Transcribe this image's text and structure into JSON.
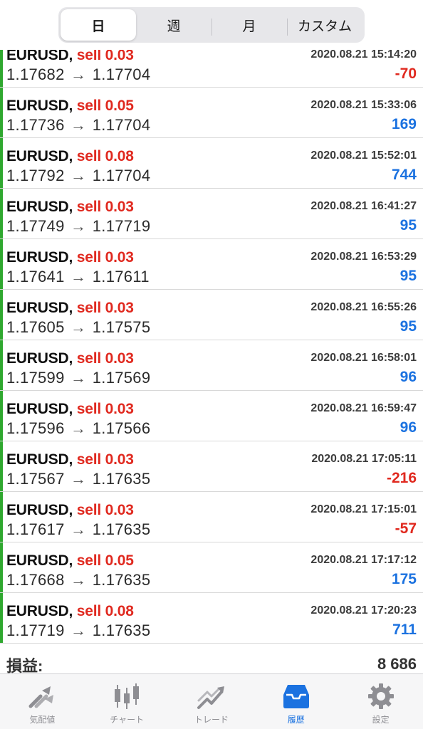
{
  "period_tabs": [
    "日",
    "週",
    "月",
    "カスタム"
  ],
  "active_period": 0,
  "trades": [
    {
      "symbol": "EURUSD",
      "action": "sell 0.03",
      "time": "2020.08.21 15:14:20",
      "open": "1.17682",
      "close": "1.17704",
      "profit": "-70",
      "positive": false
    },
    {
      "symbol": "EURUSD",
      "action": "sell 0.05",
      "time": "2020.08.21 15:33:06",
      "open": "1.17736",
      "close": "1.17704",
      "profit": "169",
      "positive": true
    },
    {
      "symbol": "EURUSD",
      "action": "sell 0.08",
      "time": "2020.08.21 15:52:01",
      "open": "1.17792",
      "close": "1.17704",
      "profit": "744",
      "positive": true
    },
    {
      "symbol": "EURUSD",
      "action": "sell 0.03",
      "time": "2020.08.21 16:41:27",
      "open": "1.17749",
      "close": "1.17719",
      "profit": "95",
      "positive": true
    },
    {
      "symbol": "EURUSD",
      "action": "sell 0.03",
      "time": "2020.08.21 16:53:29",
      "open": "1.17641",
      "close": "1.17611",
      "profit": "95",
      "positive": true
    },
    {
      "symbol": "EURUSD",
      "action": "sell 0.03",
      "time": "2020.08.21 16:55:26",
      "open": "1.17605",
      "close": "1.17575",
      "profit": "95",
      "positive": true
    },
    {
      "symbol": "EURUSD",
      "action": "sell 0.03",
      "time": "2020.08.21 16:58:01",
      "open": "1.17599",
      "close": "1.17569",
      "profit": "96",
      "positive": true
    },
    {
      "symbol": "EURUSD",
      "action": "sell 0.03",
      "time": "2020.08.21 16:59:47",
      "open": "1.17596",
      "close": "1.17566",
      "profit": "96",
      "positive": true
    },
    {
      "symbol": "EURUSD",
      "action": "sell 0.03",
      "time": "2020.08.21 17:05:11",
      "open": "1.17567",
      "close": "1.17635",
      "profit": "-216",
      "positive": false
    },
    {
      "symbol": "EURUSD",
      "action": "sell 0.03",
      "time": "2020.08.21 17:15:01",
      "open": "1.17617",
      "close": "1.17635",
      "profit": "-57",
      "positive": false
    },
    {
      "symbol": "EURUSD",
      "action": "sell 0.05",
      "time": "2020.08.21 17:17:12",
      "open": "1.17668",
      "close": "1.17635",
      "profit": "175",
      "positive": true
    },
    {
      "symbol": "EURUSD",
      "action": "sell 0.08",
      "time": "2020.08.21 17:20:23",
      "open": "1.17719",
      "close": "1.17635",
      "profit": "711",
      "positive": true
    }
  ],
  "summary": {
    "label": "損益:",
    "value": "8 686"
  },
  "tabbar": [
    {
      "label": "気配値",
      "icon": "quotes-icon"
    },
    {
      "label": "チャート",
      "icon": "chart-icon"
    },
    {
      "label": "トレード",
      "icon": "trade-icon"
    },
    {
      "label": "履歴",
      "icon": "history-icon"
    },
    {
      "label": "設定",
      "icon": "settings-icon"
    }
  ],
  "active_tab": 3,
  "colors": {
    "accent": "#1b72e0",
    "sell": "#e0291f",
    "profit_positive": "#1b72e0",
    "profit_negative": "#e0291f",
    "row_marker": "#2fa82f"
  }
}
